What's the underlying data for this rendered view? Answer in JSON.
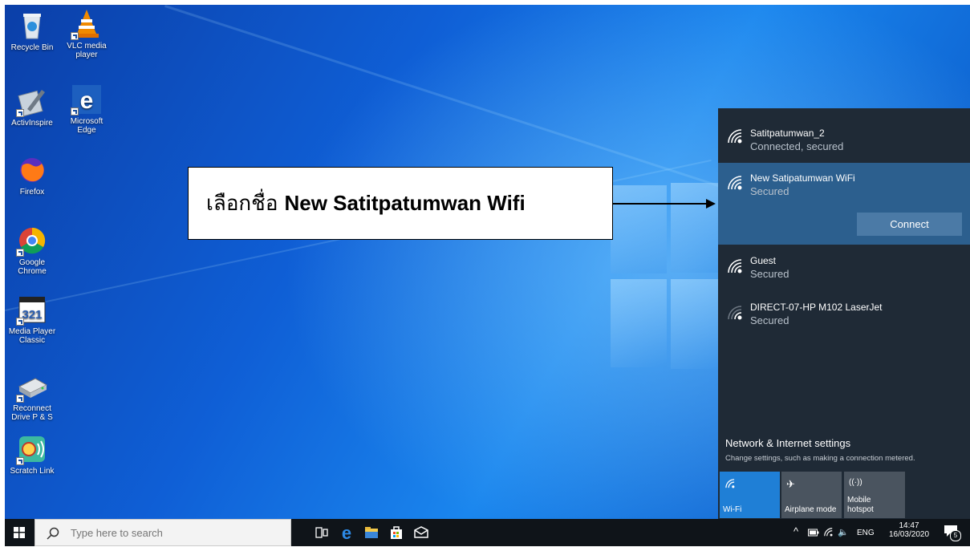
{
  "desktop": {
    "icons": [
      {
        "id": "recycle",
        "label": "Recycle Bin",
        "icon": "recycle-bin-icon"
      },
      {
        "id": "vlc",
        "label": "VLC media player",
        "icon": "vlc-icon"
      },
      {
        "id": "activinspire",
        "label": "ActivInspire",
        "icon": "activinspire-icon"
      },
      {
        "id": "edge",
        "label": "Microsoft Edge",
        "icon": "edge-icon"
      },
      {
        "id": "firefox",
        "label": "Firefox",
        "icon": "firefox-icon"
      },
      {
        "id": "chrome",
        "label": "Google Chrome",
        "icon": "chrome-icon"
      },
      {
        "id": "mpc",
        "label": "Media Player Classic",
        "icon": "media-player-classic-icon"
      },
      {
        "id": "reconnect",
        "label": "Reconnect Drive P & S",
        "icon": "drive-icon"
      },
      {
        "id": "scratch",
        "label": "Scratch Link",
        "icon": "scratch-link-icon"
      }
    ]
  },
  "callout": {
    "prefix": "เลือกชื่อ",
    "bold": "New Satitpatumwan Wifi"
  },
  "flyout": {
    "networks": [
      {
        "name": "Satitpatumwan_2",
        "status": "Connected, secured"
      },
      {
        "name": "New Satipatumwan WiFi",
        "status": "Secured",
        "connect_label": "Connect"
      },
      {
        "name": "Guest",
        "status": "Secured"
      },
      {
        "name": "DIRECT-07-HP M102 LaserJet",
        "status": "Secured"
      }
    ],
    "settings_title": "Network & Internet settings",
    "settings_subtitle": "Change settings, such as making a connection metered.",
    "quick_actions": [
      {
        "label": "Wi-Fi",
        "icon": "wifi-icon",
        "active": true
      },
      {
        "label": "Airplane mode",
        "icon": "airplane-icon",
        "active": false
      },
      {
        "label_line1": "Mobile",
        "label_line2": "hotspot",
        "icon": "hotspot-icon",
        "active": false
      }
    ]
  },
  "taskbar": {
    "search_placeholder": "Type here to search",
    "tray": {
      "language": "ENG",
      "time": "14:47",
      "date": "16/03/2020",
      "notifications": "5"
    }
  },
  "colors": {
    "accent": "#0078d7",
    "flyout_bg": "#1f2a36",
    "selected_bg": "#2c5f8e",
    "connect_btn": "#4b7aa6"
  }
}
